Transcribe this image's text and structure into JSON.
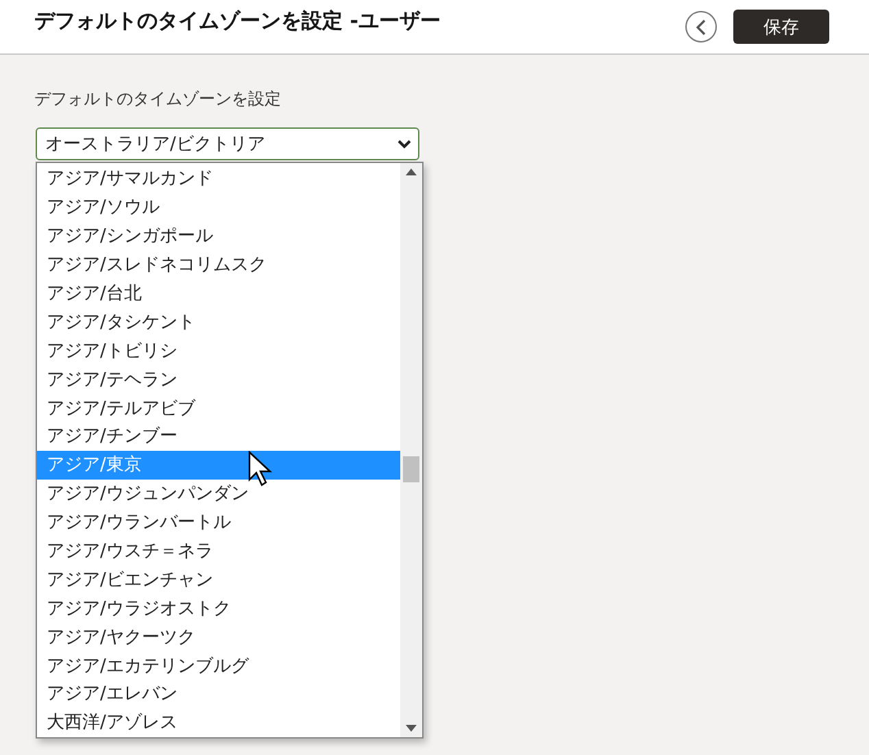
{
  "header": {
    "title": "デフォルトのタイムゾーンを設定 -ユーザー",
    "save_button": "保存"
  },
  "field": {
    "label": "デフォルトのタイムゾーンを設定",
    "value": "オーストラリア/ビクトリア"
  },
  "options": [
    {
      "label": "アジア/サマルカンド",
      "selected": false
    },
    {
      "label": "アジア/ソウル",
      "selected": false
    },
    {
      "label": "アジア/シンガポール",
      "selected": false
    },
    {
      "label": "アジア/スレドネコリムスク",
      "selected": false
    },
    {
      "label": "アジア/台北",
      "selected": false
    },
    {
      "label": "アジア/タシケント",
      "selected": false
    },
    {
      "label": "アジア/トビリシ",
      "selected": false
    },
    {
      "label": "アジア/テヘラン",
      "selected": false
    },
    {
      "label": "アジア/テルアビブ",
      "selected": false
    },
    {
      "label": "アジア/チンブー",
      "selected": false
    },
    {
      "label": "アジア/東京",
      "selected": true
    },
    {
      "label": "アジア/ウジュンパンダン",
      "selected": false
    },
    {
      "label": "アジア/ウランバートル",
      "selected": false
    },
    {
      "label": "アジア/ウスチ＝ネラ",
      "selected": false
    },
    {
      "label": "アジア/ビエンチャン",
      "selected": false
    },
    {
      "label": "アジア/ウラジオストク",
      "selected": false
    },
    {
      "label": "アジア/ヤクーツク",
      "selected": false
    },
    {
      "label": "アジア/エカテリンブルグ",
      "selected": false
    },
    {
      "label": "アジア/エレバン",
      "selected": false
    },
    {
      "label": "大西洋/アゾレス",
      "selected": false
    }
  ]
}
